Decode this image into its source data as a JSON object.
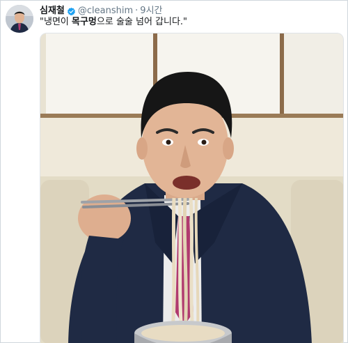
{
  "tweet": {
    "author_name": "심재철",
    "handle": "@cleanshim",
    "separator": "·",
    "time": "9시간",
    "text_open": "\"냉면이 ",
    "text_bold": "목구멍",
    "text_close": "으로 술술 넘어 갑니다.\"",
    "verified_icon": "verified-badge-icon",
    "badge_color": "#1da1f2"
  },
  "photo": {
    "subject": "man eating cold noodles with chopsticks",
    "colors": {
      "wall": "#e8e2d2",
      "window": "#f4f1e8",
      "suit": "#1f2a44",
      "tie": "#b03a6e",
      "noodles": "#e9dcc0",
      "bowl": "#a7a9ad"
    }
  }
}
